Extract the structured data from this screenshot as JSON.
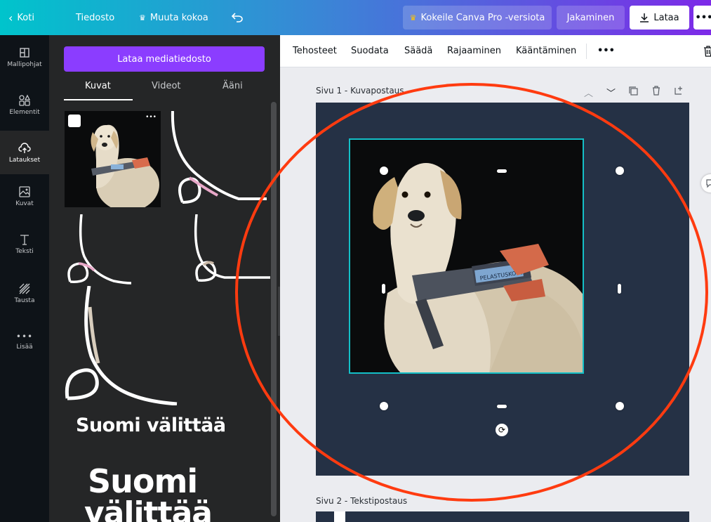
{
  "topbar": {
    "home": "Koti",
    "file": "Tiedosto",
    "resize": "Muuta kokoa",
    "pro_button": "Kokeile Canva Pro -versiota",
    "share": "Jakaminen",
    "download": "Lataa",
    "more": "•••"
  },
  "rail": {
    "items": [
      {
        "label": "Mallipohjat",
        "icon": "templates-icon"
      },
      {
        "label": "Elementit",
        "icon": "elements-icon"
      },
      {
        "label": "Lataukset",
        "icon": "uploads-icon"
      },
      {
        "label": "Kuvat",
        "icon": "photos-icon"
      },
      {
        "label": "Teksti",
        "icon": "text-icon"
      },
      {
        "label": "Tausta",
        "icon": "background-icon"
      },
      {
        "label": "Lisää",
        "icon": "more-icon"
      }
    ]
  },
  "panel": {
    "upload_button": "Lataa mediatiedosto",
    "tabs": [
      "Kuvat",
      "Videot",
      "Ääni"
    ],
    "thumb_more": "•••",
    "brand_text_small": "Suomi välittää",
    "brand_text_large_1": "Suomi",
    "brand_text_large_2": "välittää"
  },
  "context_toolbar": {
    "items": [
      "Tehosteet",
      "Suodata",
      "Säädä",
      "Rajaaminen",
      "Kääntäminen"
    ],
    "more": "•••"
  },
  "pages": [
    {
      "label": "Sivu 1 - Kuvapostaus"
    },
    {
      "label": "Sivu 2 - Tekstipostaus"
    }
  ],
  "photo": {
    "harness_text": "PELASTUSKOIRA"
  },
  "colors": {
    "accent_purple": "#8b3dff",
    "selection": "#13bfc7",
    "canvas_bg": "#253145",
    "annotation": "#ff3b10"
  }
}
